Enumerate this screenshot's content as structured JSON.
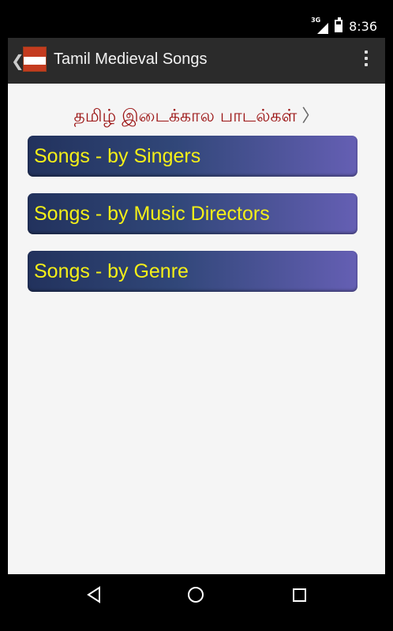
{
  "status": {
    "network": "3G",
    "time": "8:36"
  },
  "app": {
    "title": "Tamil Medieval Songs"
  },
  "content": {
    "heading": "தமிழ் இடைக்கால பாடல்கள்",
    "options": [
      {
        "label": "Songs - by Singers"
      },
      {
        "label": "Songs - by Music Directors"
      },
      {
        "label": "Songs - by Genre"
      }
    ]
  },
  "icons": {
    "menu": "overflow-menu-icon",
    "back": "back-icon",
    "home": "home-icon",
    "recent": "recent-apps-icon"
  },
  "colors": {
    "accent_text": "#f4ef18",
    "heading": "#9b1313",
    "button_start": "#22325d",
    "button_end": "#655fb4"
  }
}
